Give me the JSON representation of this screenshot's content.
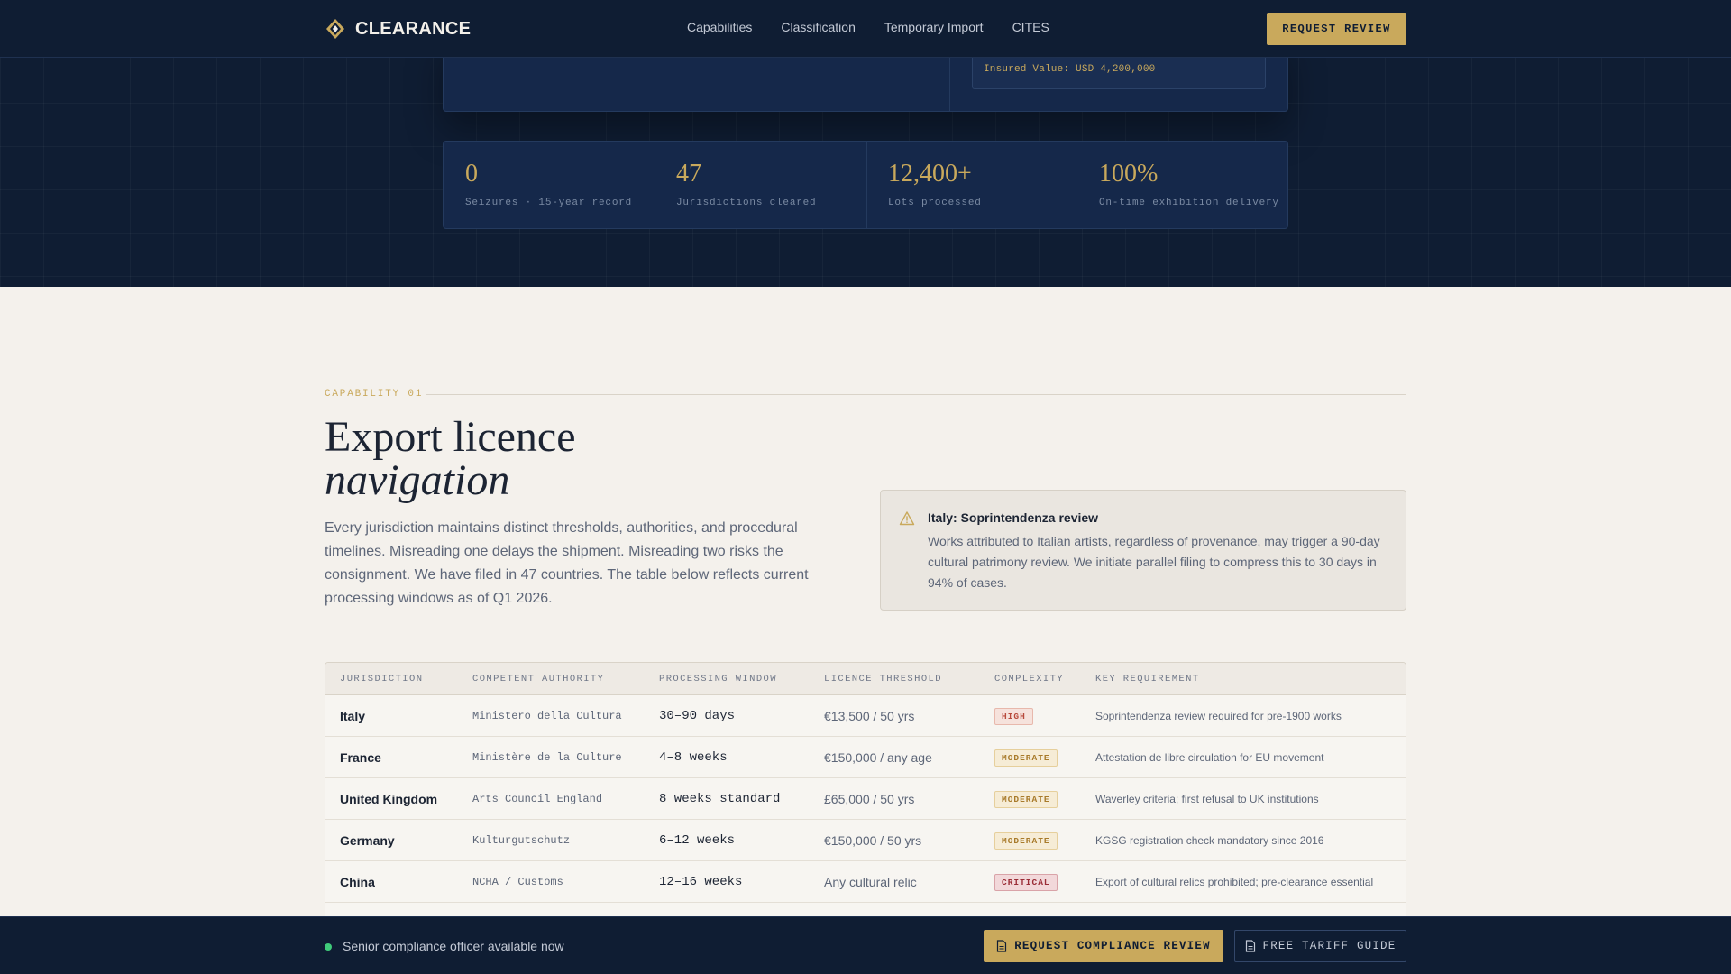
{
  "nav": {
    "brand": "CLEARANCE",
    "links": [
      "Capabilities",
      "Classification",
      "Temporary Import",
      "CITES"
    ],
    "cta": "REQUEST REVIEW"
  },
  "hero": {
    "insured_value": "Insured Value: USD 4,200,000",
    "stats": [
      {
        "value": "0",
        "label": "Seizures · 15-year record"
      },
      {
        "value": "47",
        "label": "Jurisdictions cleared"
      },
      {
        "value": "12,400+",
        "label": "Lots processed"
      },
      {
        "value": "100%",
        "label": "On-time exhibition delivery"
      }
    ]
  },
  "capability": {
    "eyebrow": "CAPABILITY 01",
    "title_line1": "Export licence",
    "title_line2": "navigation",
    "lead": "Every jurisdiction maintains distinct thresholds, authorities, and procedural timelines. Misreading one delays the shipment. Misreading two risks the consignment. We have filed in 47 countries. The table below reflects current processing windows as of Q1 2026.",
    "alert": {
      "icon": "warning-triangle-icon",
      "title": "Italy: Soprintendenza review",
      "body": "Works attributed to Italian artists, regardless of provenance, may trigger a 90-day cultural patrimony review. We initiate parallel filing to compress this to 30 days in 94% of cases."
    }
  },
  "table": {
    "headers": [
      "JURISDICTION",
      "COMPETENT AUTHORITY",
      "PROCESSING WINDOW",
      "LICENCE THRESHOLD",
      "COMPLEXITY",
      "KEY REQUIREMENT"
    ],
    "rows": [
      {
        "jurisdiction": "Italy",
        "authority": "Ministero della Cultura",
        "window": "30–90 days",
        "threshold": "€13,500 / 50 yrs",
        "complexity": "HIGH",
        "level": "high",
        "requirement": "Soprintendenza review required for pre-1900 works"
      },
      {
        "jurisdiction": "France",
        "authority": "Ministère de la Culture",
        "window": "4–8 weeks",
        "threshold": "€150,000 / any age",
        "complexity": "MODERATE",
        "level": "moderate",
        "requirement": "Attestation de libre circulation for EU movement"
      },
      {
        "jurisdiction": "United Kingdom",
        "authority": "Arts Council England",
        "window": "8 weeks standard",
        "threshold": "£65,000 / 50 yrs",
        "complexity": "MODERATE",
        "level": "moderate",
        "requirement": "Waverley criteria; first refusal to UK institutions"
      },
      {
        "jurisdiction": "Germany",
        "authority": "Kulturgutschutz",
        "window": "6–12 weeks",
        "threshold": "€150,000 / 50 yrs",
        "complexity": "MODERATE",
        "level": "moderate",
        "requirement": "KGSG registration check mandatory since 2016"
      },
      {
        "jurisdiction": "China",
        "authority": "NCHA / Customs",
        "window": "12–16 weeks",
        "threshold": "Any cultural relic",
        "complexity": "CRITICAL",
        "level": "critical",
        "requirement": "Export of cultural relics prohibited; pre-clearance essential"
      }
    ]
  },
  "footer": {
    "availability": "Senior compliance officer available now",
    "primary_cta": "REQUEST COMPLIANCE REVIEW",
    "secondary_cta": "FREE TARIFF GUIDE"
  },
  "colors": {
    "navy": "#0f1d33",
    "gold": "#c9a95c",
    "paper": "#f4f1ec",
    "online": "#3fcb7a"
  }
}
